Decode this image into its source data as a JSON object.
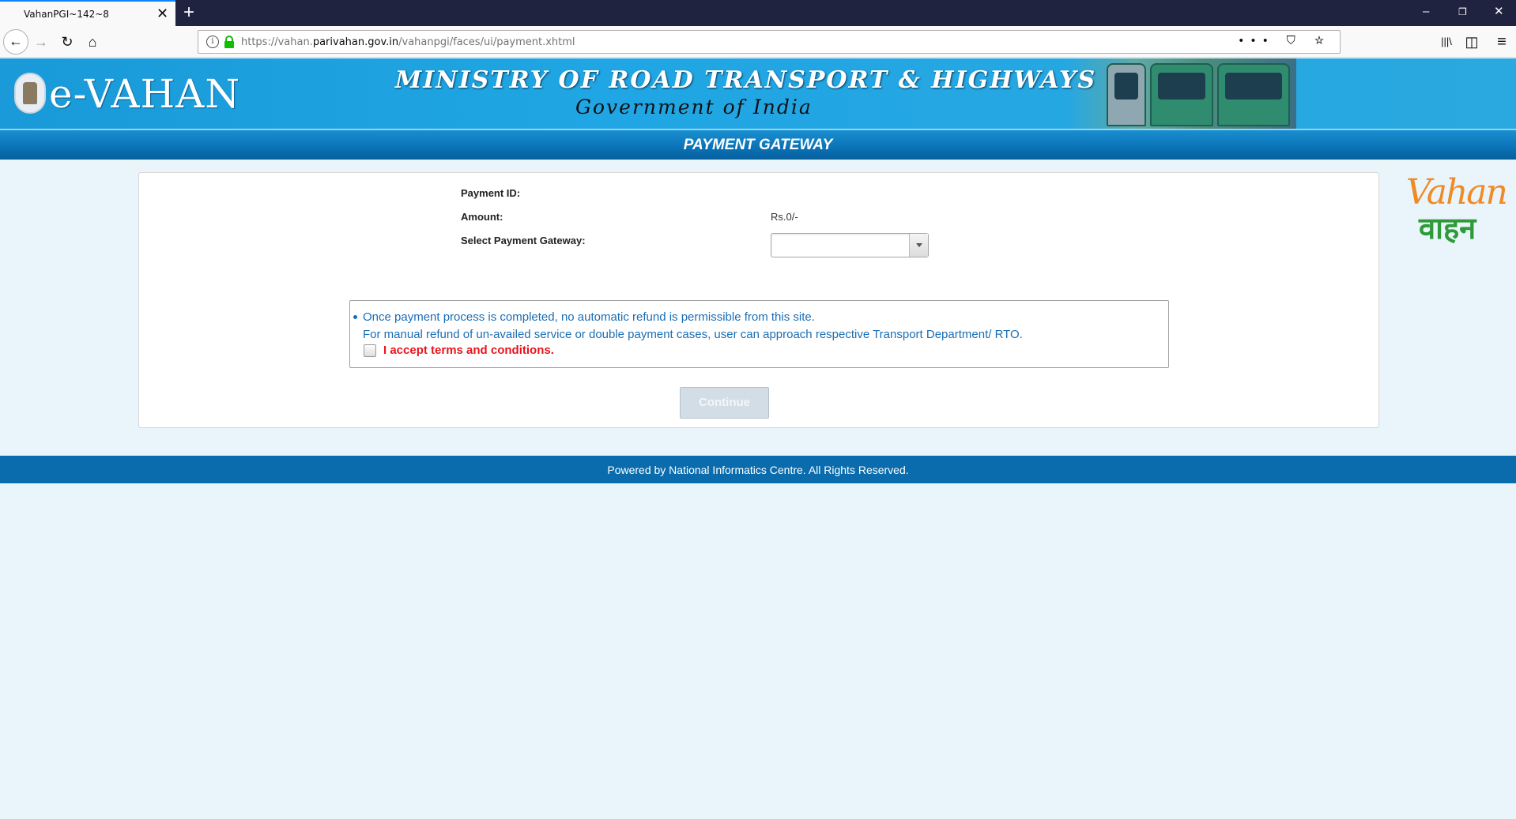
{
  "browser": {
    "tab_title": "VahanPGI~142~8",
    "tab_close": "✕",
    "new_tab": "+",
    "url_prefix": "https://vahan.",
    "url_domain": "parivahan.gov.in",
    "url_path": "/vahanpgi/faces/ui/payment.xhtml",
    "url_actions": "••• ⛉ ☆",
    "win_minimize": "–",
    "win_restore": "❐",
    "win_close": "✕",
    "icons": {
      "back": "←",
      "forward": "→",
      "reload": "↻",
      "home": "⌂",
      "library": "|||\\",
      "sidebar": "◫",
      "menu": "≡"
    }
  },
  "header": {
    "logo_text": "e-VAHAN",
    "ministry": "MINISTRY OF ROAD TRANSPORT & HIGHWAYS",
    "government": "Government of India"
  },
  "page_title": "PAYMENT GATEWAY",
  "form": {
    "payment_id_label": "Payment ID:",
    "payment_id_value": "",
    "amount_label": "Amount:",
    "amount_value": "Rs.0/-",
    "gateway_label": "Select Payment Gateway:",
    "gateway_selected": ""
  },
  "notice": {
    "line1": "Once payment process is completed, no automatic refund is permissible from this site.",
    "line2": "For manual refund of un-availed service or double payment cases, user can approach respective Transport Department/ RTO.",
    "accept_label": "I accept terms and conditions."
  },
  "continue_label": "Continue",
  "side_logo": {
    "english": "Vahan",
    "hindi": "वाहन"
  },
  "footer_text": "Powered by National Informatics Centre. All Rights Reserved."
}
